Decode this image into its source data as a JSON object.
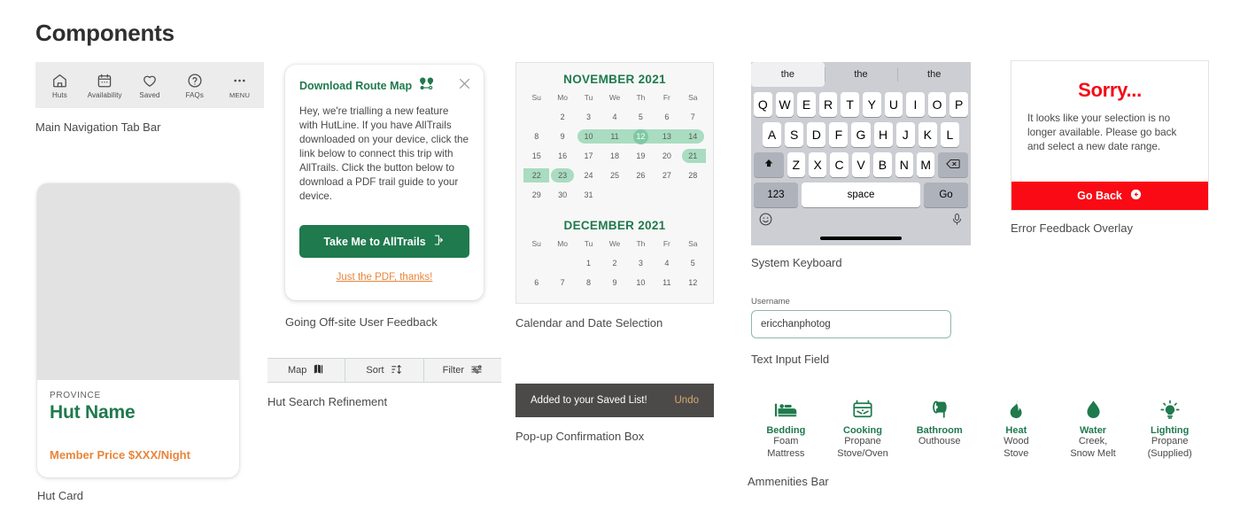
{
  "page": {
    "title": "Components"
  },
  "tabbar": {
    "caption": "Main Navigation Tab Bar",
    "items": [
      {
        "icon": "home-icon",
        "label": "Huts"
      },
      {
        "icon": "calendar-icon",
        "label": "Availability"
      },
      {
        "icon": "heart-icon",
        "label": "Saved"
      },
      {
        "icon": "question-circle-icon",
        "label": "FAQs"
      },
      {
        "icon": "ellipsis-icon",
        "label": "MENU"
      }
    ]
  },
  "hut_card": {
    "caption": "Hut Card",
    "province": "PROVINCE",
    "name": "Hut Name",
    "price": "Member Price $XXX/Night"
  },
  "dialog": {
    "caption": "Going Off-site User Feedback",
    "title": "Download Route Map",
    "body": "Hey, we're trialling a new feature with HutLine. If you have AllTrails downloaded on your device, click the link below to connect this trip with AllTrails. Click the button below to download a PDF trail guide to your device.",
    "primary_button": "Take Me to AllTrails",
    "secondary_link": "Just the PDF, thanks!"
  },
  "refinement": {
    "caption": "Hut Search Refinement",
    "buttons": [
      {
        "label": "Map",
        "icon": "map-icon"
      },
      {
        "label": "Sort",
        "icon": "sort-icon"
      },
      {
        "label": "Filter",
        "icon": "filter-icon"
      }
    ]
  },
  "calendar": {
    "caption": "Calendar and Date Selection",
    "dow": [
      "Su",
      "Mo",
      "Tu",
      "We",
      "Th",
      "Fr",
      "Sa"
    ],
    "months": [
      {
        "title": "NOVEMBER 2021",
        "lead_blanks": 1,
        "days": [
          {
            "n": 2
          },
          {
            "n": 3
          },
          {
            "n": 4
          },
          {
            "n": 5
          },
          {
            "n": 6
          },
          {
            "n": 7
          },
          {
            "n": 8
          },
          {
            "n": 9
          },
          {
            "n": 10,
            "range": "start"
          },
          {
            "n": 11,
            "range": "mid"
          },
          {
            "n": 12,
            "range": "mid",
            "selected": true
          },
          {
            "n": 13,
            "range": "mid"
          },
          {
            "n": 14,
            "range": "end"
          },
          {
            "n": 15
          },
          {
            "n": 16
          },
          {
            "n": 17
          },
          {
            "n": 18
          },
          {
            "n": 19
          },
          {
            "n": 20
          },
          {
            "n": 21,
            "range": "start"
          },
          {
            "n": 22,
            "range": "mid"
          },
          {
            "n": 23,
            "range": "only"
          },
          {
            "n": 24
          },
          {
            "n": 25
          },
          {
            "n": 26
          },
          {
            "n": 27
          },
          {
            "n": 28
          },
          {
            "n": 29
          },
          {
            "n": 30
          },
          {
            "n": 31
          }
        ]
      },
      {
        "title": "DECEMBER 2021",
        "lead_blanks": 2,
        "days": [
          {
            "n": 1
          },
          {
            "n": 2
          },
          {
            "n": 3
          },
          {
            "n": 4
          },
          {
            "n": 5
          },
          {
            "n": 6
          },
          {
            "n": 7
          },
          {
            "n": 8
          },
          {
            "n": 9
          },
          {
            "n": 10
          },
          {
            "n": 11
          },
          {
            "n": 12
          }
        ]
      }
    ]
  },
  "toast": {
    "caption": "Pop-up Confirmation Box",
    "message": "Added to your Saved List!",
    "action": "Undo"
  },
  "keyboard": {
    "caption": "System Keyboard",
    "predictions": [
      "the",
      "the",
      "the"
    ],
    "row1": [
      "Q",
      "W",
      "E",
      "R",
      "T",
      "Y",
      "U",
      "I",
      "O",
      "P"
    ],
    "row2": [
      "A",
      "S",
      "D",
      "F",
      "G",
      "H",
      "J",
      "K",
      "L"
    ],
    "row3": [
      "Z",
      "X",
      "C",
      "V",
      "B",
      "N",
      "M"
    ],
    "shift_icon": "shift-icon",
    "backspace_icon": "backspace-icon",
    "numeric_key": "123",
    "space_key": "space",
    "go_key": "Go",
    "emoji_icon": "emoji-icon",
    "mic_icon": "microphone-icon"
  },
  "text_input": {
    "caption": "Text Input Field",
    "label": "Username",
    "value": "ericchanphotog",
    "placeholder": "Username"
  },
  "error": {
    "caption": "Error Feedback Overlay",
    "title": "Sorry...",
    "body": "It looks like your selection is no longer available. Please go back and select a new date range.",
    "button": "Go Back"
  },
  "amenities": {
    "caption": "Ammenities Bar",
    "items": [
      {
        "icon": "bed-icon",
        "title": "Bedding",
        "sub": "Foam\nMattress"
      },
      {
        "icon": "stove-icon",
        "title": "Cooking",
        "sub": "Propane\nStove/Oven"
      },
      {
        "icon": "toilet-paper-icon",
        "title": "Bathroom",
        "sub": "Outhouse"
      },
      {
        "icon": "flame-icon",
        "title": "Heat",
        "sub": "Wood\nStove"
      },
      {
        "icon": "water-drop-icon",
        "title": "Water",
        "sub": "Creek,\nSnow Melt"
      },
      {
        "icon": "lightbulb-icon",
        "title": "Lighting",
        "sub": "Propane\n(Supplied)"
      }
    ]
  },
  "colors": {
    "green": "#1f7a4d",
    "orange": "#e8853a",
    "red": "#fa0a14",
    "mint": "#a9dcc0",
    "mint_dark": "#7fc9a4",
    "toast_bg": "#4c4a48",
    "toast_action": "#d9a871"
  }
}
